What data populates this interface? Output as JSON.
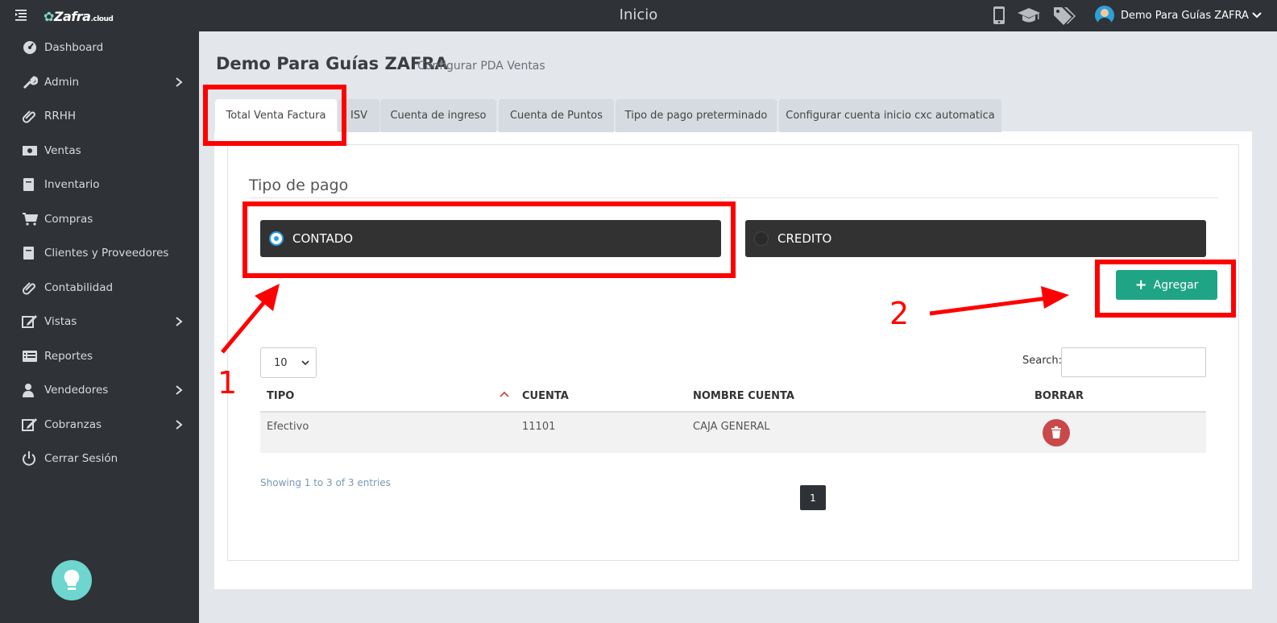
{
  "topbar": {
    "logo": "Zafra",
    "logo_tld": ".cloud",
    "title": "Inicio",
    "user_name": "Demo Para Guías ZAFRA",
    "icons": [
      "mobile-icon",
      "graduation-cap-icon",
      "tags-icon"
    ]
  },
  "sidebar": {
    "items": [
      {
        "label": "Dashboard",
        "icon": "dashboard-icon"
      },
      {
        "label": "Admin",
        "icon": "wrench-icon",
        "submenu": true
      },
      {
        "label": "RRHH",
        "icon": "paperclip-icon"
      },
      {
        "label": "Ventas",
        "icon": "money-icon"
      },
      {
        "label": "Inventario",
        "icon": "book-icon"
      },
      {
        "label": "Compras",
        "icon": "cart-icon"
      },
      {
        "label": "Clientes y Proveedores",
        "icon": "book-icon"
      },
      {
        "label": "Contabilidad",
        "icon": "paperclip-icon"
      },
      {
        "label": "Vistas",
        "icon": "edit-icon",
        "submenu": true
      },
      {
        "label": "Reportes",
        "icon": "list-icon"
      },
      {
        "label": "Vendedores",
        "icon": "user-icon",
        "submenu": true
      },
      {
        "label": "Cobranzas",
        "icon": "edit-icon",
        "submenu": true
      },
      {
        "label": "Cerrar Sesión",
        "icon": "power-icon"
      }
    ]
  },
  "page": {
    "title": "Demo Para Guías ZAFRA",
    "subtitle": "Configurar PDA Ventas"
  },
  "tabs": [
    {
      "label": "Total Venta Factura",
      "active": true
    },
    {
      "label": "ISV"
    },
    {
      "label": "Cuenta de ingreso"
    },
    {
      "label": "Cuenta de Puntos"
    },
    {
      "label": "Tipo de pago preterminado"
    },
    {
      "label": "Configurar cuenta inicio cxc automatica"
    }
  ],
  "payment": {
    "section_title": "Tipo de pago",
    "options": [
      {
        "label": "CONTADO",
        "selected": true
      },
      {
        "label": "CREDITO",
        "selected": false
      }
    ],
    "add_button": "Agregar"
  },
  "table": {
    "length_value": "10",
    "search_label": "Search:",
    "search_value": "",
    "columns": [
      "TIPO",
      "CUENTA",
      "NOMBRE CUENTA",
      "BORRAR"
    ],
    "rows": [
      {
        "tipo": "Efectivo",
        "cuenta": "11101",
        "nombre": "CAJA GENERAL"
      }
    ],
    "info": "Showing 1 to 3 of 3 entries",
    "current_page": "1"
  },
  "annotations": {
    "step1": "1",
    "step2": "2"
  },
  "colors": {
    "sidebar_bg": "#2f3237",
    "accent_green": "#20a486",
    "annotation_red": "#ff0000",
    "delete_red": "#c9494a",
    "radio_blue": "#2a9be0"
  }
}
